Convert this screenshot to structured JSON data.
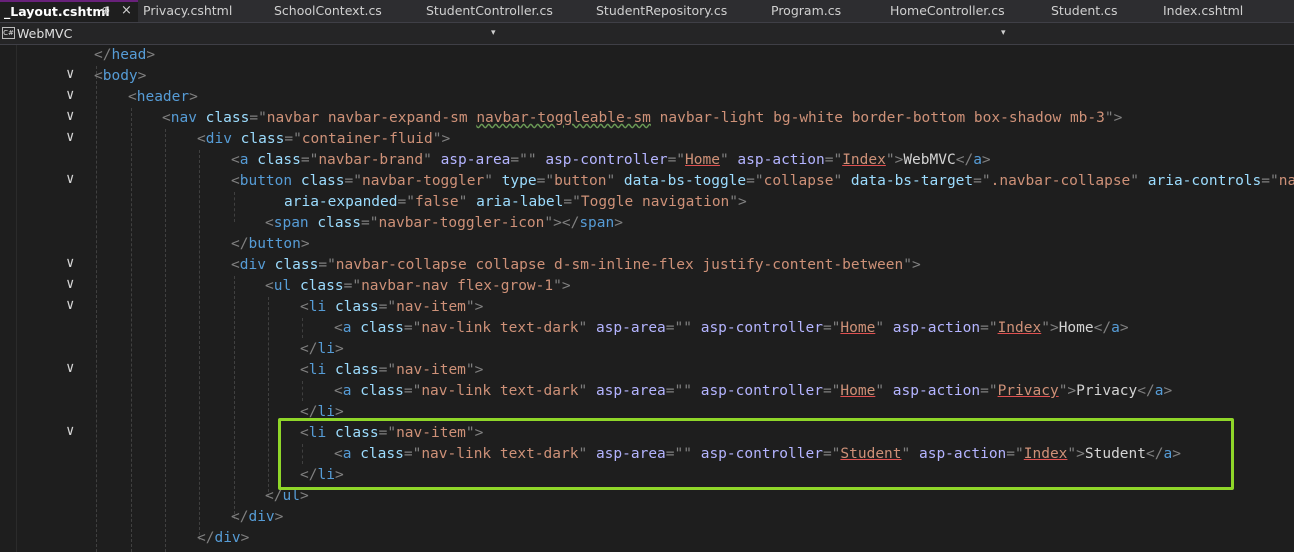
{
  "tabs": [
    {
      "label": "_Layout.cshtml",
      "active": true
    },
    {
      "label": "Privacy.cshtml"
    },
    {
      "label": "SchoolContext.cs"
    },
    {
      "label": "StudentController.cs"
    },
    {
      "label": "StudentRepository.cs"
    },
    {
      "label": "Program.cs"
    },
    {
      "label": "HomeController.cs"
    },
    {
      "label": "Student.cs"
    },
    {
      "label": "Index.cshtml"
    }
  ],
  "tab_pin_glyph": "⊕",
  "tab_close_glyph": "×",
  "project_selector": {
    "label": "WebMVC",
    "icon": "csharp-project-icon",
    "icon_text": "C#"
  },
  "dropdown_arrow": "▾",
  "fold_glyph": "∨",
  "colors": {
    "highlight_box": "#8fd629",
    "tag": "#569cd6",
    "attr": "#9cdcfe",
    "value": "#ce9178",
    "punct": "#808080"
  },
  "code_lines": [
    "</head>",
    "<body>",
    "<header>",
    "<nav class=\"navbar navbar-expand-sm navbar-toggleable-sm navbar-light bg-white border-bottom box-shadow mb-3\">",
    "<div class=\"container-fluid\">",
    "<a class=\"navbar-brand\" asp-area=\"\" asp-controller=\"Home\" asp-action=\"Index\">WebMVC</a>",
    "<button class=\"navbar-toggler\" type=\"button\" data-bs-toggle=\"collapse\" data-bs-target=\".navbar-collapse\" aria-controls=\"navb",
    "aria-expanded=\"false\" aria-label=\"Toggle navigation\">",
    "<span class=\"navbar-toggler-icon\"></span>",
    "</button>",
    "<div class=\"navbar-collapse collapse d-sm-inline-flex justify-content-between\">",
    "<ul class=\"navbar-nav flex-grow-1\">",
    "<li class=\"nav-item\">",
    "<a class=\"nav-link text-dark\" asp-area=\"\" asp-controller=\"Home\" asp-action=\"Index\">Home</a>",
    "</li>",
    "<li class=\"nav-item\">",
    "<a class=\"nav-link text-dark\" asp-area=\"\" asp-controller=\"Home\" asp-action=\"Privacy\">Privacy</a>",
    "</li>",
    "<li class=\"nav-item\">",
    "<a class=\"nav-link text-dark\" asp-area=\"\" asp-controller=\"Student\" asp-action=\"Index\">Student</a>",
    "</li>",
    "</ul>",
    "</div>",
    "</div>"
  ]
}
